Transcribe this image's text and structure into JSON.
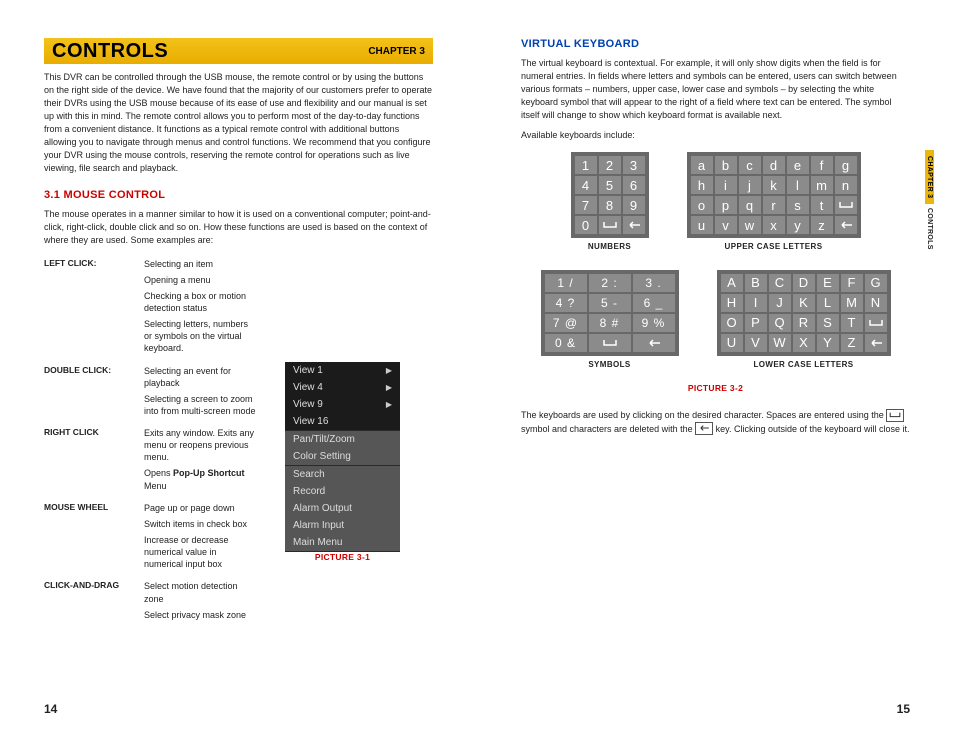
{
  "left": {
    "title": "CONTROLS",
    "chapter": "CHAPTER 3",
    "intro": "This DVR can be controlled through the USB mouse, the remote control or by using the buttons on the right side of the device. We have found that the majority of our customers prefer to operate their DVRs using the USB mouse because of its ease of use and flexibility and our manual is set up with this in mind. The remote control allows you to perform most of the day-to-day functions from a convenient distance. It functions as a typical remote control with additional buttons allowing you to navigate through menus and control functions.  We recommend that you configure your DVR using the mouse controls, reserving the remote control for operations such as live viewing, file search and playback.",
    "section31": "3.1 Mouse Control",
    "section31_body": "The mouse operates in a manner similar to how it is used on a conventional computer; point-and-click, right-click, double click and so on. How these functions are used is based on the context of where they are used. Some examples are:",
    "mouse": [
      {
        "action": "LEFT CLICK:",
        "items": [
          "Selecting an item",
          "Opening a menu",
          "Checking a box or motion detection status",
          "Selecting letters, numbers or symbols on the virtual keyboard."
        ]
      },
      {
        "action": "DOUBLE CLICK:",
        "items": [
          "Selecting an event for playback",
          "Selecting a screen to zoom into from multi-screen mode"
        ]
      },
      {
        "action": "RIGHT CLICK",
        "items": [
          "Exits any window. Exits any menu or reopens previous menu.",
          "Opens <b>Pop-Up Shortcut</b> Menu"
        ]
      },
      {
        "action": "MOUSE WHEEL",
        "items": [
          "Page up or page down",
          "Switch items in check box",
          "Increase or decrease numerical value in numerical input box"
        ]
      },
      {
        "action": "CLICK-AND-DRAG",
        "items": [
          "Select motion detection zone",
          "Select privacy mask zone"
        ]
      }
    ],
    "popup_caption": "PICTURE 3-1",
    "popup_groups": [
      {
        "style": "blk",
        "rows": [
          {
            "label": "View 1",
            "arrow": true
          },
          {
            "label": "View 4",
            "arrow": true
          },
          {
            "label": "View 9",
            "arrow": true
          },
          {
            "label": "View 16",
            "arrow": false
          }
        ]
      },
      {
        "style": "grp2",
        "rows": [
          {
            "label": "Pan/Tilt/Zoom"
          },
          {
            "label": "Color Setting"
          }
        ]
      },
      {
        "style": "grp2",
        "rows": [
          {
            "label": "Search"
          },
          {
            "label": "Record"
          },
          {
            "label": "Alarm Output"
          },
          {
            "label": "Alarm Input"
          },
          {
            "label": "Main Menu"
          }
        ]
      }
    ],
    "pagenum": "14"
  },
  "right": {
    "section": "Virtual Keyboard",
    "body1": "The virtual keyboard is contextual. For example, it will only show digits when the field is for numeral entries. In fields where letters and symbols can be entered, users can switch between various formats – numbers, upper case, lower case and symbols – by selecting the white keyboard symbol that will appear to the right of a field where text can be entered. The symbol itself will change to show which keyboard format is available next.",
    "body2": "Available keyboards include:",
    "keyboards": {
      "numbers": {
        "caption": "NUMBERS",
        "keys": [
          "1",
          "2",
          "3",
          "4",
          "5",
          "6",
          "7",
          "8",
          "9",
          "0",
          "space",
          "back"
        ]
      },
      "upper": {
        "caption": "UPPER CASE LETTERS",
        "keys": [
          "a",
          "b",
          "c",
          "d",
          "e",
          "f",
          "g",
          "h",
          "i",
          "j",
          "k",
          "l",
          "m",
          "n",
          "o",
          "p",
          "q",
          "r",
          "s",
          "t",
          "space",
          "u",
          "v",
          "w",
          "x",
          "y",
          "z",
          "back"
        ]
      },
      "symbols": {
        "caption": "SYMBOLS",
        "keys": [
          "1 /",
          "2 :",
          "3 .",
          "4 ?",
          "5 -",
          "6 _",
          "7 @",
          "8 #",
          "9 %",
          "0 &",
          "space",
          "back"
        ]
      },
      "lower": {
        "caption": "LOWER CASE LETTERS",
        "keys": [
          "A",
          "B",
          "C",
          "D",
          "E",
          "F",
          "G",
          "H",
          "I",
          "J",
          "K",
          "L",
          "M",
          "N",
          "O",
          "P",
          "Q",
          "R",
          "S",
          "T",
          "space",
          "U",
          "V",
          "W",
          "X",
          "Y",
          "Z",
          "back"
        ]
      }
    },
    "picture": "PICTURE 3-2",
    "body3a": "The keyboards are used by clicking on the desired character. Spaces are entered using the ",
    "body3b": " symbol and characters are deleted with the ",
    "body3c": " key. Clicking outside of the keyboard will close it.",
    "vtab_top": "CHAPTER 3",
    "vtab_bot": "CONTROLS",
    "pagenum": "15"
  }
}
